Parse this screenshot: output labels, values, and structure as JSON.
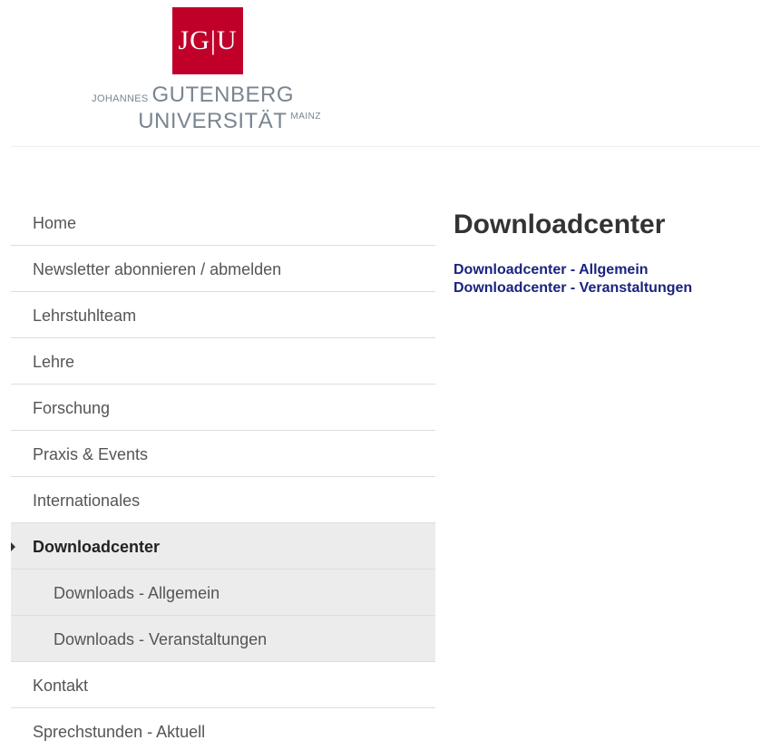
{
  "logo": {
    "mark": "JG|U",
    "line1_prefix": "JOHANNES",
    "line1_main": "GUTENBERG",
    "line2_main": "UNIVERSITÄT",
    "line2_suffix": "MAINZ",
    "colors": {
      "mark_background": "#c1002a",
      "wordmark_text": "#7a8591"
    }
  },
  "sidebar": {
    "items": [
      {
        "label": "Home"
      },
      {
        "label": "Newsletter abonnieren / abmelden"
      },
      {
        "label": "Lehrstuhlteam"
      },
      {
        "label": "Lehre"
      },
      {
        "label": "Forschung"
      },
      {
        "label": "Praxis & Events"
      },
      {
        "label": "Internationales"
      },
      {
        "label": "Downloadcenter",
        "active": true,
        "icon": "caret-right-icon"
      },
      {
        "label": "Downloads - Allgemein",
        "sub": true
      },
      {
        "label": "Downloads - Veranstaltungen",
        "sub": true
      },
      {
        "label": "Kontakt"
      },
      {
        "label": "Sprechstunden - Aktuell"
      }
    ]
  },
  "main": {
    "title": "Downloadcenter",
    "links": [
      {
        "label": "Downloadcenter - Allgemein"
      },
      {
        "label": "Downloadcenter - Veranstaltungen"
      }
    ],
    "colors": {
      "link": "#1a237e",
      "title": "#333333"
    }
  }
}
